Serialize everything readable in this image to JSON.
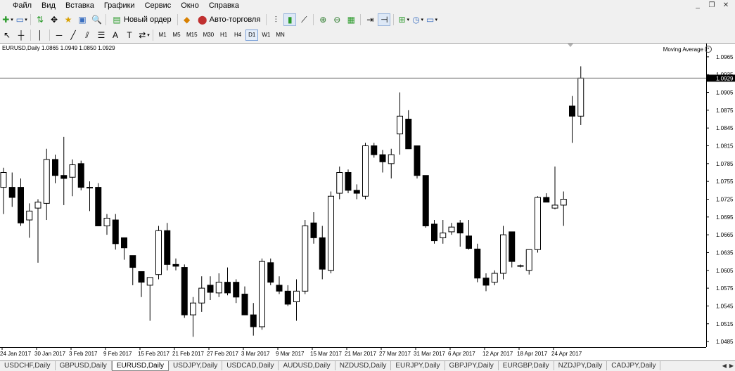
{
  "menu": [
    "Файл",
    "Вид",
    "Вставка",
    "Графики",
    "Сервис",
    "Окно",
    "Справка"
  ],
  "window_controls": [
    "minimize-icon",
    "restore-icon",
    "close-icon"
  ],
  "toolbar": {
    "new_order_label": "Новый ордер",
    "autotrading_label": "Авто-торговля",
    "timeframes": [
      "M1",
      "M5",
      "M15",
      "M30",
      "H1",
      "H4",
      "D1",
      "W1",
      "MN"
    ],
    "active_timeframe": "D1"
  },
  "chart": {
    "title": "EURUSD,Daily  1.0865 1.0949 1.0850 1.0929",
    "indicator_label": "Moving Average",
    "current_price_label": "1.0929",
    "colors": {
      "bull_fill": "#ffffff",
      "bear_fill": "#000000",
      "wick": "#000000",
      "price_line": "#808080"
    }
  },
  "chart_data": {
    "type": "candlestick",
    "symbol": "EURUSD",
    "timeframe": "Daily",
    "price_ticks": [
      "1.0965",
      "1.0935",
      "1.0905",
      "1.0875",
      "1.0845",
      "1.0815",
      "1.0785",
      "1.0755",
      "1.0725",
      "1.0695",
      "1.0665",
      "1.0635",
      "1.0605",
      "1.0575",
      "1.0545",
      "1.0515",
      "1.0485"
    ],
    "date_labels": [
      "24 Jan 2017",
      "30 Jan 2017",
      "3 Feb 2017",
      "9 Feb 2017",
      "15 Feb 2017",
      "21 Feb 2017",
      "27 Feb 2017",
      "3 Mar 2017",
      "9 Mar 2017",
      "15 Mar 2017",
      "21 Mar 2017",
      "27 Mar 2017",
      "31 Mar 2017",
      "6 Apr 2017",
      "12 Apr 2017",
      "18 Apr 2017",
      "24 Apr 2017"
    ],
    "ylim": [
      1.0478,
      1.0985
    ],
    "current_price": 1.0929,
    "candles": [
      {
        "o": 1.0745,
        "h": 1.0778,
        "l": 1.07,
        "c": 1.077
      },
      {
        "o": 1.0745,
        "h": 1.077,
        "l": 1.0712,
        "c": 1.0728
      },
      {
        "o": 1.0745,
        "h": 1.076,
        "l": 1.068,
        "c": 1.0685
      },
      {
        "o": 1.069,
        "h": 1.0718,
        "l": 1.066,
        "c": 1.0705
      },
      {
        "o": 1.071,
        "h": 1.0725,
        "l": 1.0618,
        "c": 1.072
      },
      {
        "o": 1.0718,
        "h": 1.081,
        "l": 1.069,
        "c": 1.0792
      },
      {
        "o": 1.0792,
        "h": 1.08,
        "l": 1.0752,
        "c": 1.0765
      },
      {
        "o": 1.0765,
        "h": 1.083,
        "l": 1.0715,
        "c": 1.076
      },
      {
        "o": 1.0762,
        "h": 1.0792,
        "l": 1.073,
        "c": 1.0783
      },
      {
        "o": 1.0785,
        "h": 1.079,
        "l": 1.074,
        "c": 1.0745
      },
      {
        "o": 1.0745,
        "h": 1.0755,
        "l": 1.0705,
        "c": 1.0745
      },
      {
        "o": 1.0745,
        "h": 1.0752,
        "l": 1.068,
        "c": 1.068
      },
      {
        "o": 1.068,
        "h": 1.07,
        "l": 1.0665,
        "c": 1.0693
      },
      {
        "o": 1.069,
        "h": 1.07,
        "l": 1.064,
        "c": 1.065
      },
      {
        "o": 1.066,
        "h": 1.066,
        "l": 1.0623,
        "c": 1.0643
      },
      {
        "o": 1.063,
        "h": 1.063,
        "l": 1.058,
        "c": 1.061
      },
      {
        "o": 1.0603,
        "h": 1.0603,
        "l": 1.056,
        "c": 1.0585
      },
      {
        "o": 1.058,
        "h": 1.059,
        "l": 1.052,
        "c": 1.0593
      },
      {
        "o": 1.0598,
        "h": 1.068,
        "l": 1.059,
        "c": 1.0672
      },
      {
        "o": 1.0672,
        "h": 1.0685,
        "l": 1.0605,
        "c": 1.0615
      },
      {
        "o": 1.0615,
        "h": 1.0625,
        "l": 1.0605,
        "c": 1.0612
      },
      {
        "o": 1.061,
        "h": 1.0615,
        "l": 1.0525,
        "c": 1.053
      },
      {
        "o": 1.053,
        "h": 1.056,
        "l": 1.0493,
        "c": 1.055
      },
      {
        "o": 1.055,
        "h": 1.0595,
        "l": 1.0535,
        "c": 1.0575
      },
      {
        "o": 1.058,
        "h": 1.0595,
        "l": 1.0555,
        "c": 1.0568
      },
      {
        "o": 1.0567,
        "h": 1.06,
        "l": 1.056,
        "c": 1.0585
      },
      {
        "o": 1.0585,
        "h": 1.061,
        "l": 1.0563,
        "c": 1.0567
      },
      {
        "o": 1.0585,
        "h": 1.059,
        "l": 1.055,
        "c": 1.056
      },
      {
        "o": 1.0565,
        "h": 1.0578,
        "l": 1.053,
        "c": 1.053
      },
      {
        "o": 1.053,
        "h": 1.055,
        "l": 1.0495,
        "c": 1.051
      },
      {
        "o": 1.051,
        "h": 1.0625,
        "l": 1.0505,
        "c": 1.062
      },
      {
        "o": 1.0618,
        "h": 1.0625,
        "l": 1.058,
        "c": 1.0585
      },
      {
        "o": 1.058,
        "h": 1.0595,
        "l": 1.0565,
        "c": 1.057
      },
      {
        "o": 1.057,
        "h": 1.058,
        "l": 1.0545,
        "c": 1.0548
      },
      {
        "o": 1.0552,
        "h": 1.059,
        "l": 1.052,
        "c": 1.057
      },
      {
        "o": 1.057,
        "h": 1.069,
        "l": 1.0565,
        "c": 1.068
      },
      {
        "o": 1.0685,
        "h": 1.0703,
        "l": 1.065,
        "c": 1.066
      },
      {
        "o": 1.066,
        "h": 1.068,
        "l": 1.059,
        "c": 1.0607
      },
      {
        "o": 1.0605,
        "h": 1.0738,
        "l": 1.06,
        "c": 1.073
      },
      {
        "o": 1.0735,
        "h": 1.078,
        "l": 1.0725,
        "c": 1.077
      },
      {
        "o": 1.077,
        "h": 1.0775,
        "l": 1.0735,
        "c": 1.074
      },
      {
        "o": 1.074,
        "h": 1.075,
        "l": 1.0725,
        "c": 1.0735
      },
      {
        "o": 1.073,
        "h": 1.082,
        "l": 1.0725,
        "c": 1.0815
      },
      {
        "o": 1.0815,
        "h": 1.082,
        "l": 1.0795,
        "c": 1.08
      },
      {
        "o": 1.08,
        "h": 1.0808,
        "l": 1.077,
        "c": 1.0788
      },
      {
        "o": 1.0785,
        "h": 1.081,
        "l": 1.076,
        "c": 1.08
      },
      {
        "o": 1.0835,
        "h": 1.0905,
        "l": 1.08,
        "c": 1.0865
      },
      {
        "o": 1.086,
        "h": 1.0875,
        "l": 1.081,
        "c": 1.081
      },
      {
        "o": 1.0815,
        "h": 1.0815,
        "l": 1.076,
        "c": 1.0765
      },
      {
        "o": 1.0765,
        "h": 1.0765,
        "l": 1.0677,
        "c": 1.068
      },
      {
        "o": 1.0683,
        "h": 1.069,
        "l": 1.065,
        "c": 1.0655
      },
      {
        "o": 1.066,
        "h": 1.069,
        "l": 1.065,
        "c": 1.0668
      },
      {
        "o": 1.067,
        "h": 1.0685,
        "l": 1.0665,
        "c": 1.0678
      },
      {
        "o": 1.0685,
        "h": 1.069,
        "l": 1.0645,
        "c": 1.0668
      },
      {
        "o": 1.0663,
        "h": 1.069,
        "l": 1.064,
        "c": 1.0642
      },
      {
        "o": 1.0641,
        "h": 1.065,
        "l": 1.0585,
        "c": 1.0592
      },
      {
        "o": 1.0592,
        "h": 1.06,
        "l": 1.057,
        "c": 1.058
      },
      {
        "o": 1.0585,
        "h": 1.0605,
        "l": 1.058,
        "c": 1.06
      },
      {
        "o": 1.06,
        "h": 1.068,
        "l": 1.059,
        "c": 1.0665
      },
      {
        "o": 1.067,
        "h": 1.067,
        "l": 1.061,
        "c": 1.062
      },
      {
        "o": 1.0613,
        "h": 1.0615,
        "l": 1.061,
        "c": 1.0612
      },
      {
        "o": 1.0605,
        "h": 1.064,
        "l": 1.0598,
        "c": 1.064
      },
      {
        "o": 1.064,
        "h": 1.073,
        "l": 1.0635,
        "c": 1.0728
      },
      {
        "o": 1.0728,
        "h": 1.0735,
        "l": 1.072,
        "c": 1.072
      },
      {
        "o": 1.071,
        "h": 1.078,
        "l": 1.0708,
        "c": 1.0715
      },
      {
        "o": 1.0715,
        "h": 1.0738,
        "l": 1.068,
        "c": 1.0725
      },
      {
        "o": 1.0882,
        "h": 1.0899,
        "l": 1.082,
        "c": 1.0865
      },
      {
        "o": 1.0865,
        "h": 1.0949,
        "l": 1.085,
        "c": 1.0929
      }
    ]
  },
  "tabs": [
    "USDCHF,Daily",
    "GBPUSD,Daily",
    "EURUSD,Daily",
    "USDJPY,Daily",
    "USDCAD,Daily",
    "AUDUSD,Daily",
    "NZDUSD,Daily",
    "EURJPY,Daily",
    "GBPJPY,Daily",
    "EURGBP,Daily",
    "NZDJPY,Daily",
    "CADJPY,Daily"
  ],
  "active_tab": "EURUSD,Daily"
}
